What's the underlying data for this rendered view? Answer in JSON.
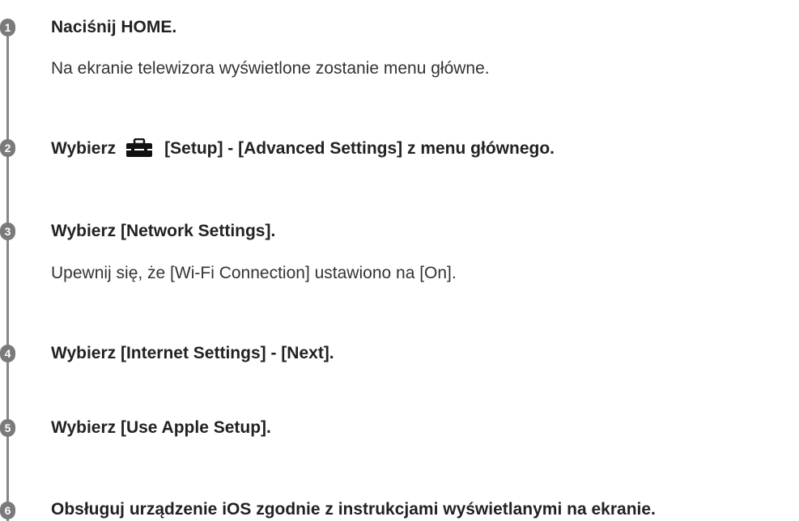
{
  "steps": [
    {
      "number": "1",
      "heading": "Naciśnij HOME.",
      "description": "Na ekranie telewizora wyświetlone zostanie menu główne."
    },
    {
      "number": "2",
      "heading_prefix": "Wybierz",
      "heading_icon": "toolbox-icon",
      "heading_suffix": "[Setup] - [Advanced Settings] z menu głównego."
    },
    {
      "number": "3",
      "heading": "Wybierz [Network Settings].",
      "description": "Upewnij się, że [Wi-Fi Connection] ustawiono na [On]."
    },
    {
      "number": "4",
      "heading": "Wybierz [Internet Settings] - [Next]."
    },
    {
      "number": "5",
      "heading": "Wybierz [Use Apple Setup]."
    },
    {
      "number": "6",
      "heading": "Obsługuj urządzenie iOS zgodnie z instrukcjami wyświetlanymi na ekranie."
    }
  ],
  "colors": {
    "badge": "#7a7a7a",
    "timeline": "#888888",
    "text": "#222222"
  }
}
